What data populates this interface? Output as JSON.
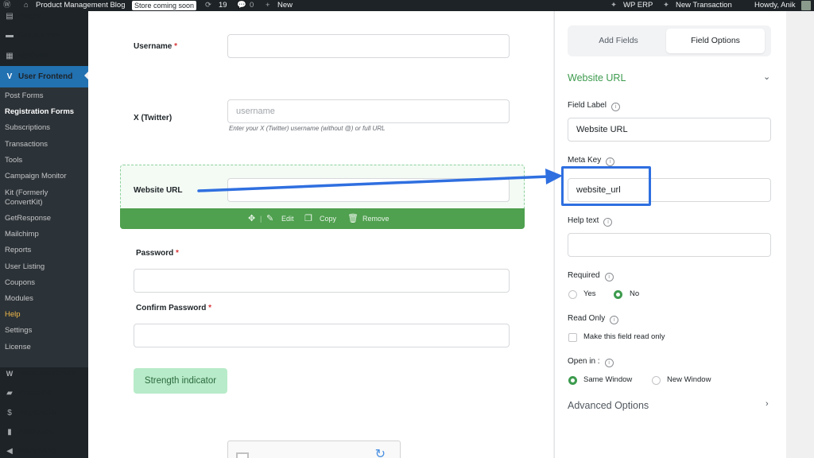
{
  "admin_bar": {
    "site_name": "Product Management Blog",
    "store_badge": "Store coming soon",
    "updates_count": "19",
    "comments_count": "0",
    "new_label": "New",
    "erp_label": "WP ERP",
    "transaction_label": "New Transaction",
    "howdy": "Howdy, Anik"
  },
  "sidebar": {
    "pages": "Pages",
    "comments": "Comments",
    "wedocs": "weDocs",
    "user_frontend": "User Frontend",
    "submenu": [
      "Post Forms",
      "Registration Forms",
      "Subscriptions",
      "Transactions",
      "Tools",
      "Campaign Monitor",
      "Kit (Formerly ConvertKit)",
      "GetResponse",
      "Mailchimp",
      "Reports",
      "User Listing",
      "Coupons",
      "Modules",
      "Help",
      "Settings",
      "License"
    ],
    "woocommerce": "WooCommerce",
    "products": "Products",
    "payments": "Payments",
    "analytics": "Analytics",
    "marketing": "Marketing"
  },
  "form": {
    "username_label": "Username",
    "required_mark": "*",
    "twitter_label": "X (Twitter)",
    "twitter_placeholder": "username",
    "twitter_help": "Enter your X (Twitter) username (without @) or full URL",
    "website_label": "Website URL",
    "actions": {
      "edit": "Edit",
      "copy": "Copy",
      "remove": "Remove"
    },
    "password_label": "Password",
    "confirm_password_label": "Confirm Password",
    "strength_button": "Strength indicator"
  },
  "panel": {
    "tab_add_fields": "Add Fields",
    "tab_field_options": "Field Options",
    "field_title": "Website URL",
    "field_label_label": "Field Label",
    "field_label_value": "Website URL",
    "meta_key_label": "Meta Key",
    "meta_key_value": "website_url",
    "help_text_label": "Help text",
    "help_text_value": "",
    "required_label": "Required",
    "required_yes": "Yes",
    "required_no": "No",
    "required_selected": "No",
    "read_only_label": "Read Only",
    "read_only_option": "Make this field read only",
    "open_in_label": "Open in :",
    "open_same": "Same Window",
    "open_new": "New Window",
    "open_selected": "Same Window",
    "advanced": "Advanced Options"
  },
  "colors": {
    "admin_bg": "#1d2327",
    "active_menu": "#2271b1",
    "green_accent": "#3d9b4e",
    "action_bar": "#4fa04f",
    "annotation_blue": "#2f6fe0"
  }
}
